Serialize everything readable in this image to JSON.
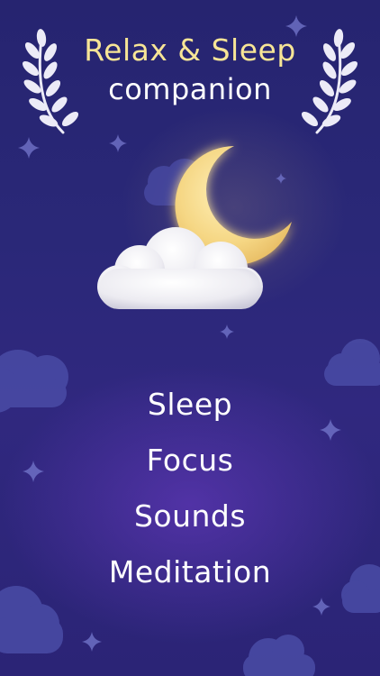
{
  "header": {
    "title_line1": "Relax & Sleep",
    "title_line2": "companion"
  },
  "menu": {
    "items": [
      {
        "label": "Sleep"
      },
      {
        "label": "Focus"
      },
      {
        "label": "Sounds"
      },
      {
        "label": "Meditation"
      }
    ]
  },
  "colors": {
    "background": "#2a2878",
    "title_accent": "#f7e596",
    "menu_text": "#ffffff",
    "moon": "#f6d98a",
    "background_cloud": "#4a4ca6"
  },
  "icons": [
    "laurel-left-icon",
    "laurel-right-icon",
    "crescent-moon-icon",
    "cloud-icon",
    "sparkle-star-icon"
  ]
}
